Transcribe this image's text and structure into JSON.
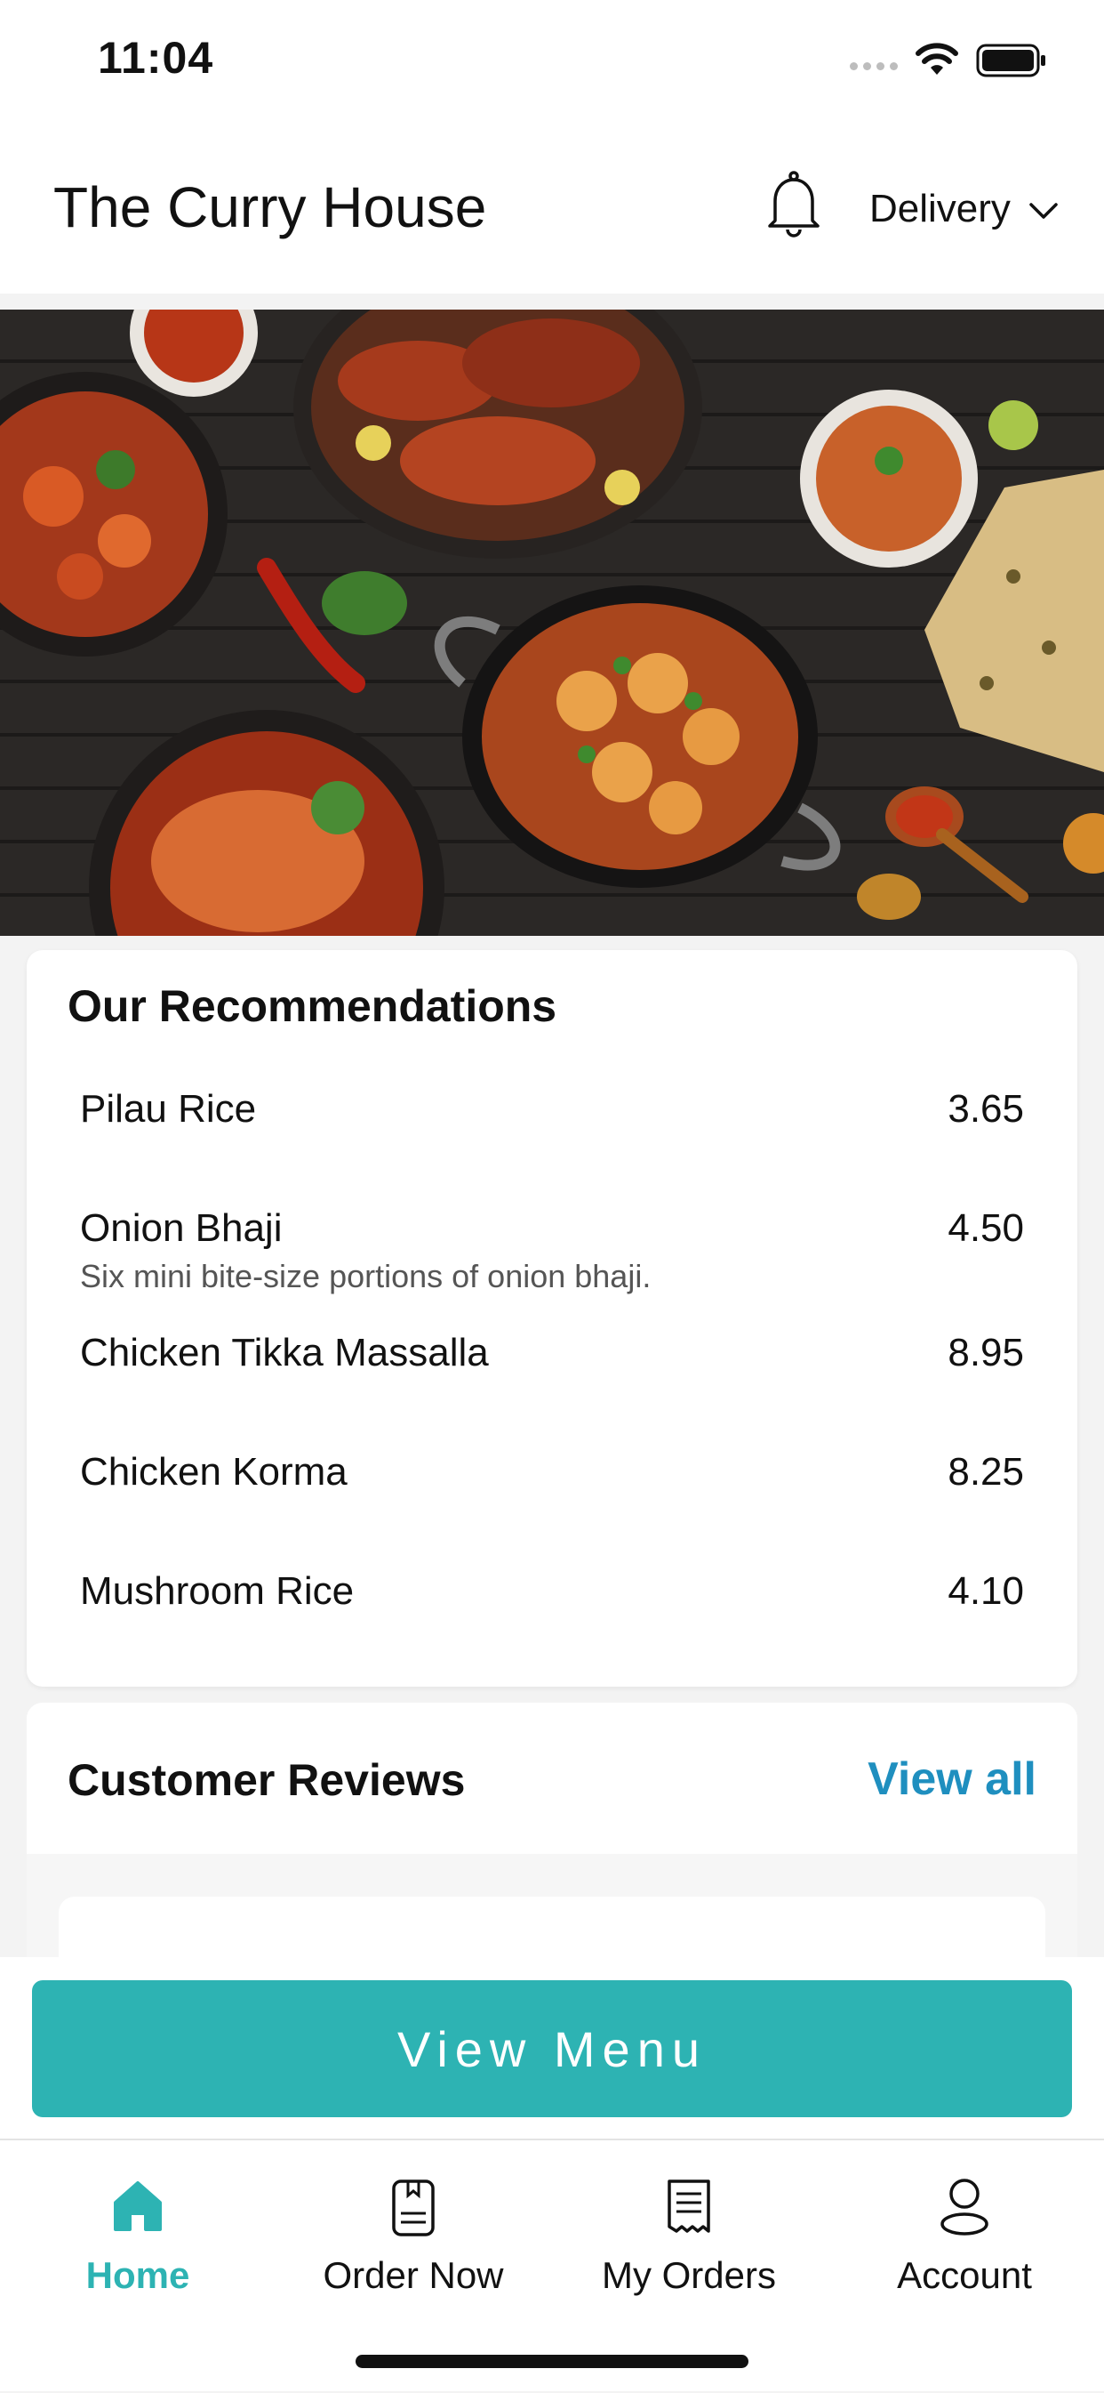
{
  "status_bar": {
    "time": "11:04"
  },
  "header": {
    "title": "The Curry House",
    "delivery_mode": "Delivery"
  },
  "recommendations": {
    "heading": "Our Recommendations",
    "items": [
      {
        "name": "Pilau Rice",
        "price": "3.65",
        "description": ""
      },
      {
        "name": "Onion Bhaji",
        "price": "4.50",
        "description": "Six mini bite-size portions of onion bhaji."
      },
      {
        "name": "Chicken Tikka Massalla",
        "price": "8.95",
        "description": ""
      },
      {
        "name": "Chicken Korma",
        "price": "8.25",
        "description": ""
      },
      {
        "name": "Mushroom Rice",
        "price": "4.10",
        "description": ""
      }
    ]
  },
  "reviews": {
    "title": "Customer Reviews",
    "view_all": "View all"
  },
  "cta": {
    "label": "View Menu"
  },
  "tabs": [
    {
      "label": "Home",
      "icon": "home-icon",
      "active": true
    },
    {
      "label": "Order Now",
      "icon": "menu-book-icon",
      "active": false
    },
    {
      "label": "My Orders",
      "icon": "receipt-icon",
      "active": false
    },
    {
      "label": "Account",
      "icon": "user-icon",
      "active": false
    }
  ],
  "colors": {
    "accent": "#2db3b3",
    "link": "#1f8fbf",
    "text": "#111111"
  }
}
